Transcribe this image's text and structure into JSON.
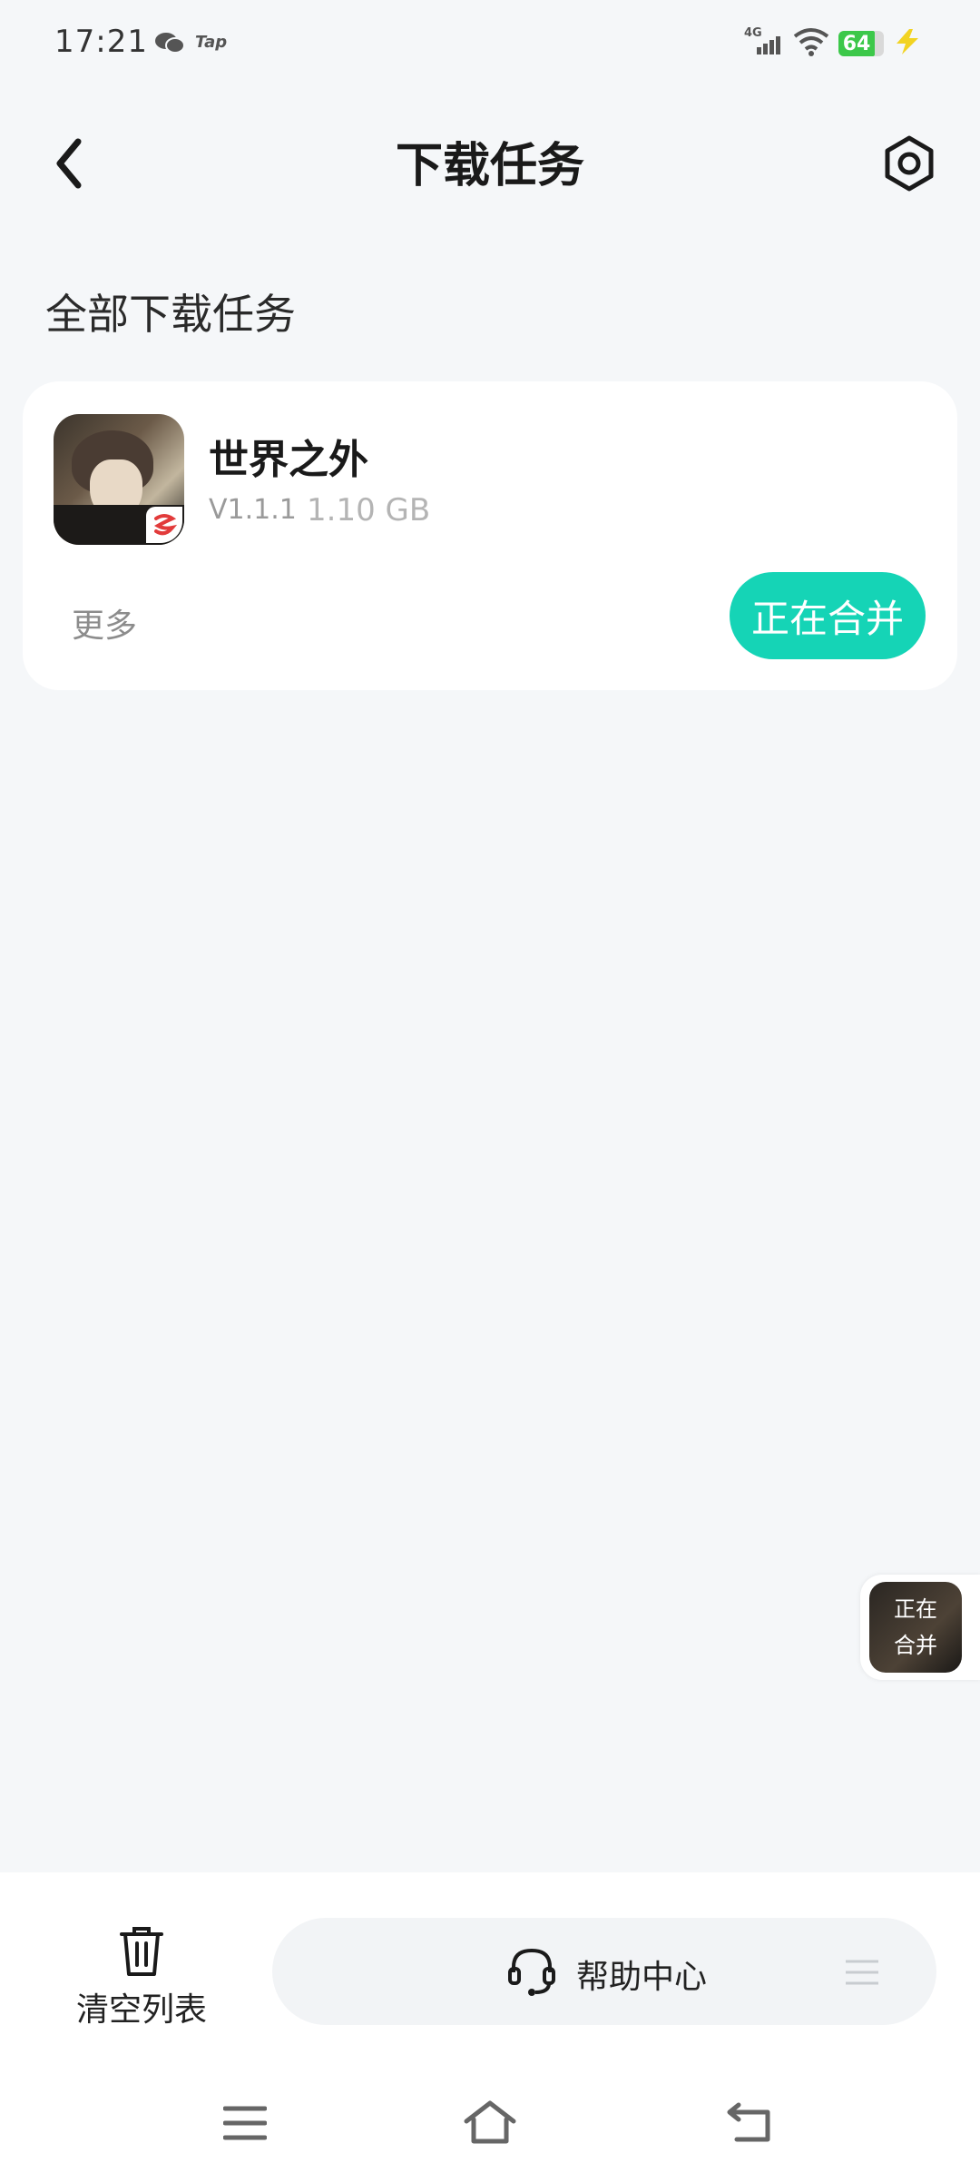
{
  "status_bar": {
    "time": "17:21",
    "tap_label": "Tap",
    "network": "4G",
    "battery": "64",
    "icons": [
      "wechat-icon",
      "tap-icon",
      "signal-icon",
      "wifi-icon",
      "battery-icon",
      "charging-icon"
    ]
  },
  "header": {
    "title": "下载任务",
    "back_icon": "chevron-left-icon",
    "settings_icon": "hexagon-gear-icon"
  },
  "section": {
    "title": "全部下载任务"
  },
  "task": {
    "name": "世界之外",
    "version": "V1.1.1",
    "size": "1.10 GB",
    "more_label": "更多",
    "status_label": "正在合并",
    "badge": "网易",
    "accent": "#15d4b6"
  },
  "float_widget": {
    "line1": "正在",
    "line2": "合并"
  },
  "bottom_bar": {
    "clear_label": "清空列表",
    "help_label": "帮助中心"
  }
}
